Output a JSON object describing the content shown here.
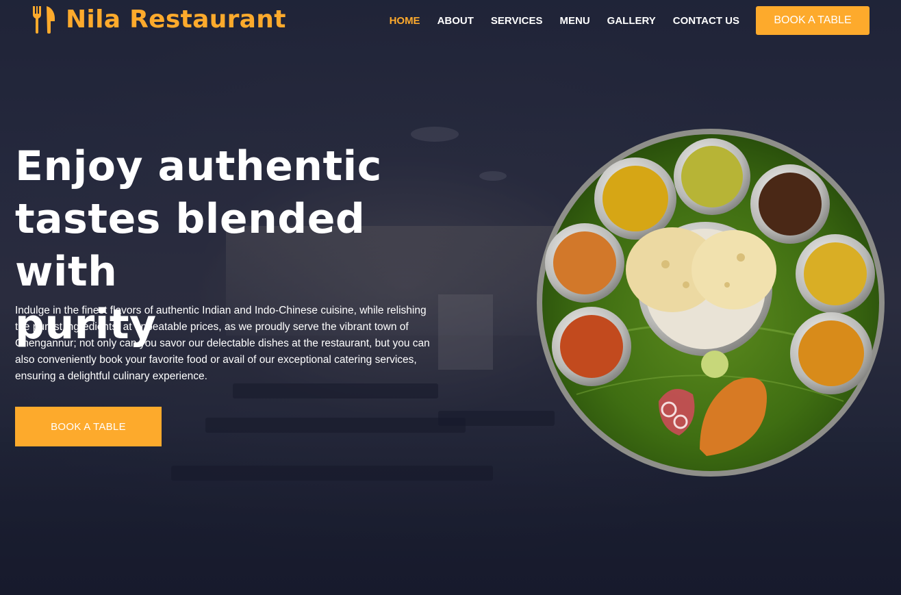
{
  "brand": {
    "name": "Nila Restaurant",
    "accent_color": "#fdaa2c",
    "logo_icon": "fork-knife-icon"
  },
  "nav": {
    "items": [
      {
        "label": "HOME",
        "active": true
      },
      {
        "label": "ABOUT",
        "active": false
      },
      {
        "label": "SERVICES",
        "active": false
      },
      {
        "label": "MENU",
        "active": false
      },
      {
        "label": "GALLERY",
        "active": false
      },
      {
        "label": "CONTACT US",
        "active": false
      }
    ],
    "cta_label": "BOOK A TABLE"
  },
  "hero": {
    "title_lines": [
      "Enjoy authentic",
      "tastes blended with",
      "purity"
    ],
    "description": "Indulge in the finest flavors of authentic Indian and Indo-Chinese cuisine, while relishing the purest ingredients, at unbeatable prices, as we proudly serve the vibrant town of Chengannur; not only can you savor our delectable dishes at the restaurant, but you can also conveniently book your favorite food or avail of our exceptional catering services, ensuring a delightful culinary experience.",
    "cta_label": "BOOK A TABLE",
    "image": "thali-plate-image",
    "background": "restaurant-interior-photo"
  }
}
